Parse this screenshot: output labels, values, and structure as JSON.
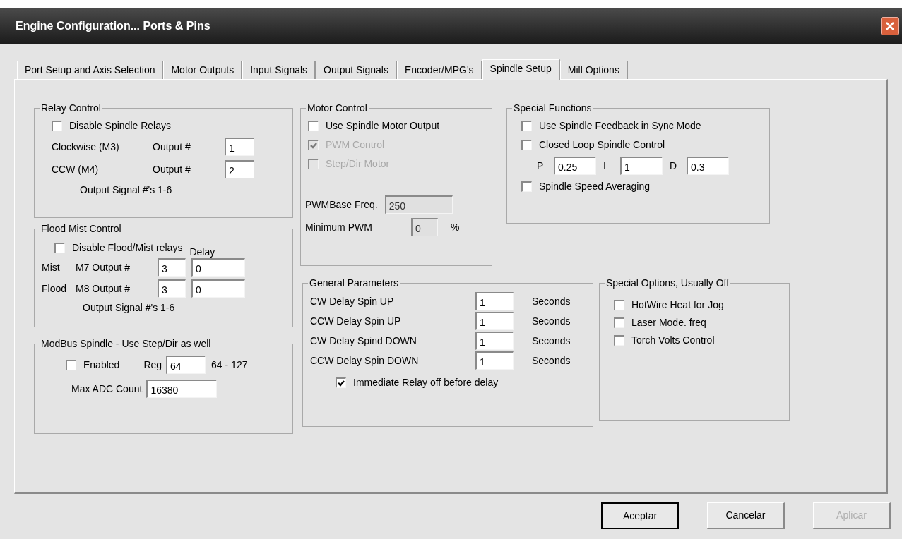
{
  "window": {
    "title": "Engine Configuration... Ports & Pins"
  },
  "tabs": [
    {
      "label": "Port Setup and Axis Selection",
      "selected": false
    },
    {
      "label": "Motor Outputs",
      "selected": false
    },
    {
      "label": "Input Signals",
      "selected": false
    },
    {
      "label": "Output Signals",
      "selected": false
    },
    {
      "label": "Encoder/MPG's",
      "selected": false
    },
    {
      "label": "Spindle Setup",
      "selected": true
    },
    {
      "label": "Mill Options",
      "selected": false
    }
  ],
  "relay_control": {
    "title": "Relay Control",
    "disable": {
      "label": "Disable Spindle Relays",
      "checked": false
    },
    "outputs": [
      {
        "name": "Clockwise (M3)",
        "label": "Output #",
        "value": "1"
      },
      {
        "name": "CCW (M4)",
        "label": "Output #",
        "value": "2"
      }
    ],
    "note": "Output Signal #'s 1-6"
  },
  "flood_mist_control": {
    "title": "Flood Mist Control",
    "disable": {
      "label": "Disable Flood/Mist relays",
      "checked": false
    },
    "delay_header": "Delay",
    "outputs": [
      {
        "name": "Mist",
        "label": "M7 Output #",
        "value": "3",
        "delay": "0"
      },
      {
        "name": "Flood",
        "label": "M8 Output #",
        "value": "3",
        "delay": "0"
      }
    ],
    "note": "Output Signal #'s 1-6"
  },
  "modbus_spindle": {
    "title": "ModBus Spindle - Use Step/Dir as well",
    "enabled": {
      "label": "Enabled",
      "checked": false
    },
    "reg_label": "Reg",
    "reg": "64",
    "range": "64 - 127",
    "max_adc_label": "Max ADC Count",
    "max_adc": "16380"
  },
  "motor_control": {
    "title": "Motor Control",
    "options": [
      {
        "label": "Use Spindle Motor Output",
        "checked": false,
        "disabled": false
      },
      {
        "label": "PWM Control",
        "checked": true,
        "disabled": true
      },
      {
        "label": "Step/Dir Motor",
        "checked": false,
        "disabled": true
      }
    ],
    "pwm_base_freq": {
      "label": "PWMBase Freq.",
      "value": "250",
      "disabled": true
    },
    "minimum_pwm": {
      "label": "Minimum PWM",
      "value": "0",
      "unit": "%",
      "disabled": true
    }
  },
  "special_functions": {
    "title": "Special Functions",
    "options": [
      {
        "label": "Use Spindle Feedback in Sync Mode",
        "checked": false
      },
      {
        "label": "Closed Loop Spindle Control",
        "checked": false
      }
    ],
    "pid": [
      {
        "label": "P",
        "value": "0.25"
      },
      {
        "label": "I",
        "value": "1"
      },
      {
        "label": "D",
        "value": "0.3"
      }
    ],
    "averaging": {
      "label": "Spindle Speed Averaging",
      "checked": false
    }
  },
  "general_parameters": {
    "title": "General Parameters",
    "delays": [
      {
        "label": "CW Delay Spin UP",
        "value": "1",
        "unit": "Seconds"
      },
      {
        "label": "CCW Delay Spin UP",
        "value": "1",
        "unit": "Seconds"
      },
      {
        "label": "CW Delay Spind DOWN",
        "value": "1",
        "unit": "Seconds"
      },
      {
        "label": "CCW Delay Spin DOWN",
        "value": "1",
        "unit": "Seconds"
      }
    ],
    "immediate_relay_off": {
      "label": "Immediate Relay off before delay",
      "checked": true
    }
  },
  "special_options": {
    "title": "Special Options, Usually Off",
    "options": [
      {
        "label": "HotWire Heat for Jog",
        "checked": false
      },
      {
        "label": "Laser Mode. freq",
        "checked": false
      },
      {
        "label": "Torch Volts Control",
        "checked": false
      }
    ]
  },
  "buttons": [
    {
      "label": "Aceptar",
      "default": true,
      "disabled": false
    },
    {
      "label": "Cancelar",
      "default": false,
      "disabled": false
    },
    {
      "label": "Aplicar",
      "default": false,
      "disabled": true
    }
  ]
}
